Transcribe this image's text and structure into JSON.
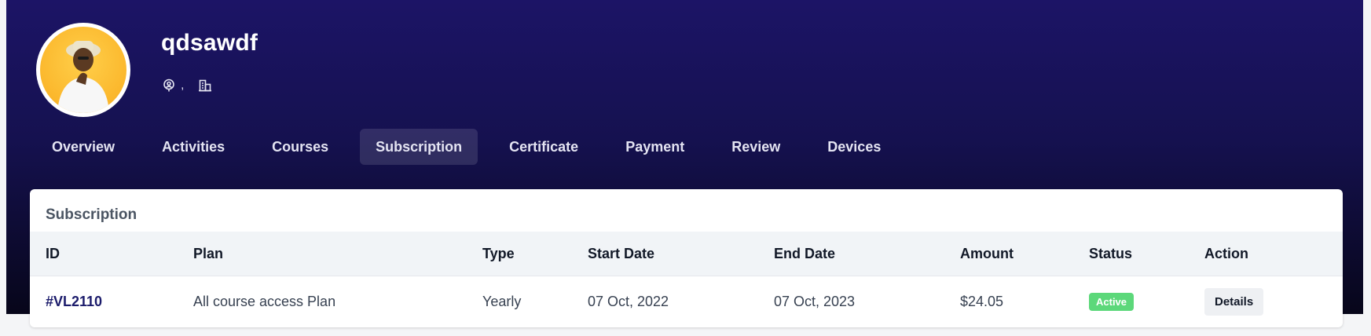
{
  "profile": {
    "name": "qdsawdf",
    "location_separator": ","
  },
  "tabs": [
    {
      "label": "Overview"
    },
    {
      "label": "Activities"
    },
    {
      "label": "Courses"
    },
    {
      "label": "Subscription",
      "active": true
    },
    {
      "label": "Certificate"
    },
    {
      "label": "Payment"
    },
    {
      "label": "Review"
    },
    {
      "label": "Devices"
    }
  ],
  "subscription": {
    "title": "Subscription",
    "columns": [
      "ID",
      "Plan",
      "Type",
      "Start Date",
      "End Date",
      "Amount",
      "Status",
      "Action"
    ],
    "rows": [
      {
        "id": "#VL2110",
        "plan": "All course access Plan",
        "type": "Yearly",
        "start_date": "07 Oct, 2022",
        "end_date": "07 Oct, 2023",
        "amount": "$24.05",
        "status": "Active",
        "action": "Details"
      }
    ]
  },
  "icons": {
    "location": "location-pin-icon",
    "company": "building-icon"
  },
  "colors": {
    "hero_top": "#1c1466",
    "hero_bottom": "#07061a",
    "link": "#1b1b6b",
    "status_active": "#5cd87a"
  }
}
